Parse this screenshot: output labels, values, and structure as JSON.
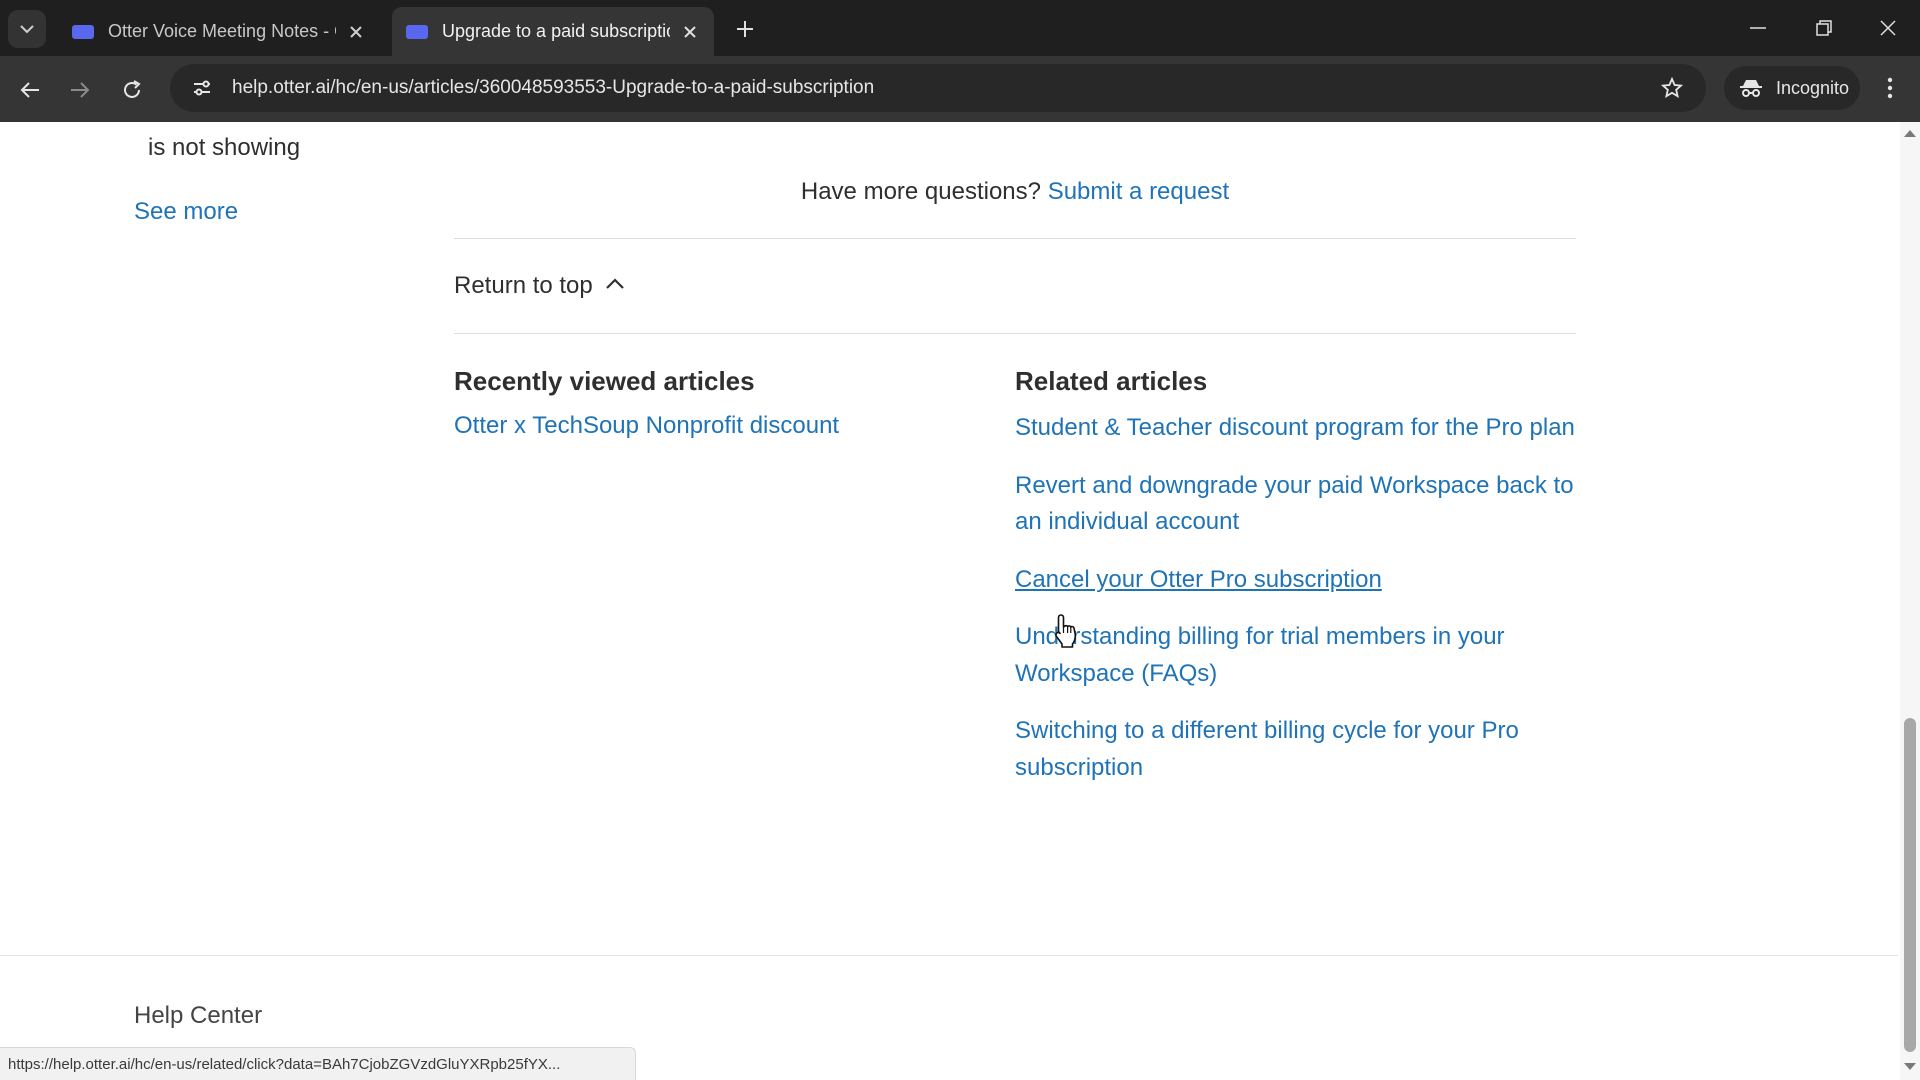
{
  "browser": {
    "tabs": [
      {
        "title": "Otter Voice Meeting Notes - Ot",
        "active": false
      },
      {
        "title": "Upgrade to a paid subscription",
        "active": true
      }
    ],
    "url": "help.otter.ai/hc/en-us/articles/360048593553-Upgrade-to-a-paid-subscription",
    "incognito_label": "Incognito",
    "status_url": "https://help.otter.ai/hc/en-us/related/click?data=BAh7CjobZGVzdGluYXRpb25fYX..."
  },
  "sidebar": {
    "trailing_text": "is not showing",
    "see_more": "See more"
  },
  "article_footer": {
    "question": "Have more questions?",
    "submit_link": "Submit a request",
    "return_to_top": "Return to top"
  },
  "recently_viewed": {
    "heading": "Recently viewed articles",
    "items": [
      "Otter x TechSoup Nonprofit discount"
    ]
  },
  "related": {
    "heading": "Related articles",
    "items": [
      "Student & Teacher discount program for the Pro plan",
      "Revert and downgrade your paid Workspace back to an individual account",
      "Cancel your Otter Pro subscription",
      "Understanding billing for trial members in your Workspace (FAQs)",
      "Switching to a different billing cycle for your Pro subscription"
    ],
    "hovered_index": 2
  },
  "footer": {
    "title": "Help Center"
  },
  "colors": {
    "link": "#1f73b7",
    "text": "#2f2f2f",
    "chrome_dark": "#1f1f1f",
    "chrome_toolbar": "#353535"
  }
}
